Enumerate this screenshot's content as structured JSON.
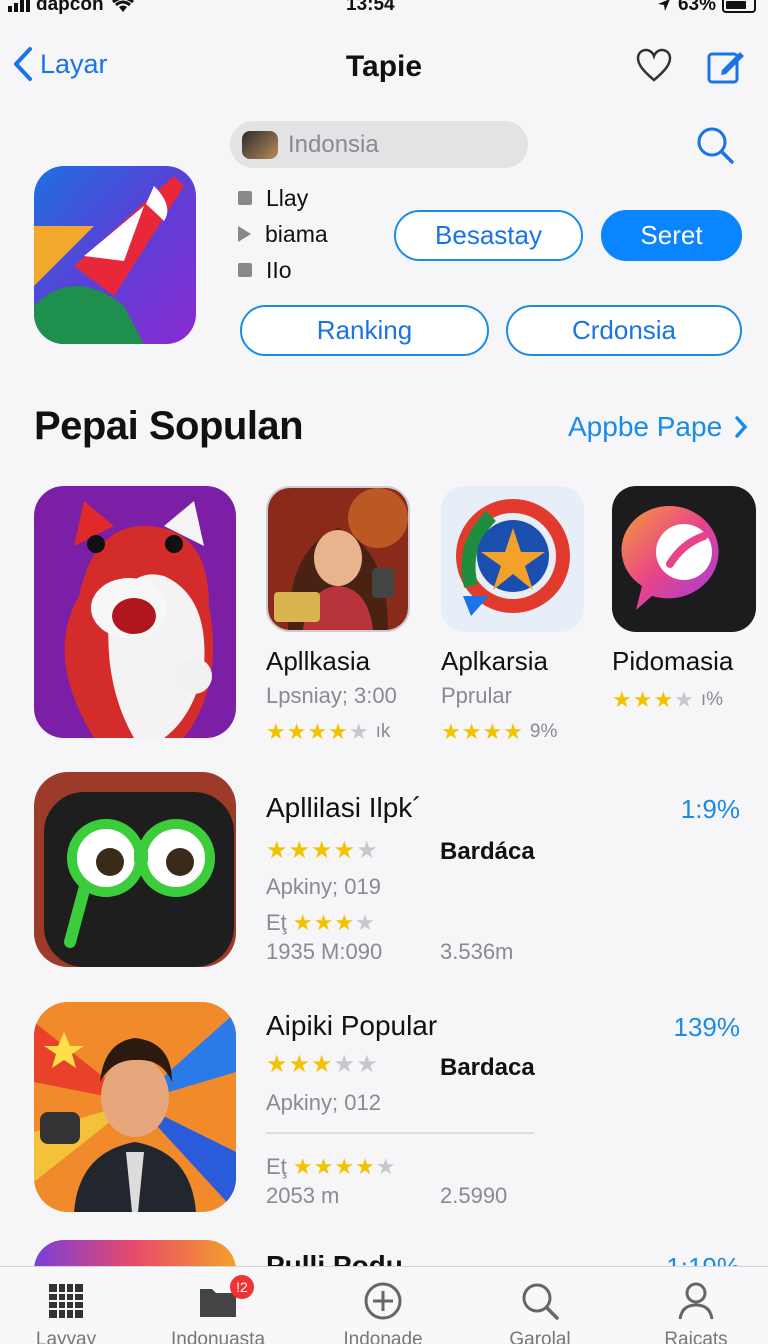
{
  "status": {
    "carrier": "dapcon",
    "time": "13:54",
    "battery": "63%"
  },
  "nav": {
    "back_label": "Layar",
    "title": "Tapie"
  },
  "search": {
    "placeholder": "Indonsia"
  },
  "filters": [
    {
      "label": "Llay"
    },
    {
      "label": "biama"
    },
    {
      "label": "IΙo"
    }
  ],
  "buttons": {
    "besastay": "Besastay",
    "seret": "Seret",
    "ranking": "Ranking",
    "crdonsia": "Crdonsia"
  },
  "section": {
    "title": "Pepai Sopulan",
    "see_all": "Appbe Pape"
  },
  "featured": [
    {
      "name": "Apllkasia",
      "subtitle": "Lpsniay; 3:00",
      "stars": 4,
      "rating": "ık"
    },
    {
      "name": "Aplkarsia",
      "subtitle": "Pprular",
      "stars": 4,
      "rating": "9%"
    },
    {
      "name": "Pidomasia",
      "subtitle": "",
      "stars": 3.5,
      "rating": "ı%"
    }
  ],
  "list": [
    {
      "title": "Apllilasi Ilpk´",
      "percent": "1:9%",
      "stars": 4,
      "developer": "Bardáca",
      "subtitle": "Apkiny; 019",
      "meta_prefix": "Eţ",
      "meta_stars": 3,
      "size": "1935 M:090",
      "downloads": "3.536m"
    },
    {
      "title": "Aipiki Popular",
      "percent": "139%",
      "stars": 3.5,
      "developer": "Bardaca",
      "subtitle": "Apkiny; 012",
      "meta_prefix": "Eţ",
      "meta_stars": 3.5,
      "size": "2053 m",
      "downloads": "2.5990"
    },
    {
      "title": "Pulli Podu",
      "percent": "1:19%"
    }
  ],
  "tabs": [
    {
      "label": "Layyay"
    },
    {
      "label": "Indonuasta",
      "badge": "!2"
    },
    {
      "label": "Indonade"
    },
    {
      "label": "Garolal"
    },
    {
      "label": "Raicats"
    }
  ],
  "colors": {
    "accent": "#0a84ff",
    "link": "#1a8be8",
    "star": "#f2c300"
  }
}
